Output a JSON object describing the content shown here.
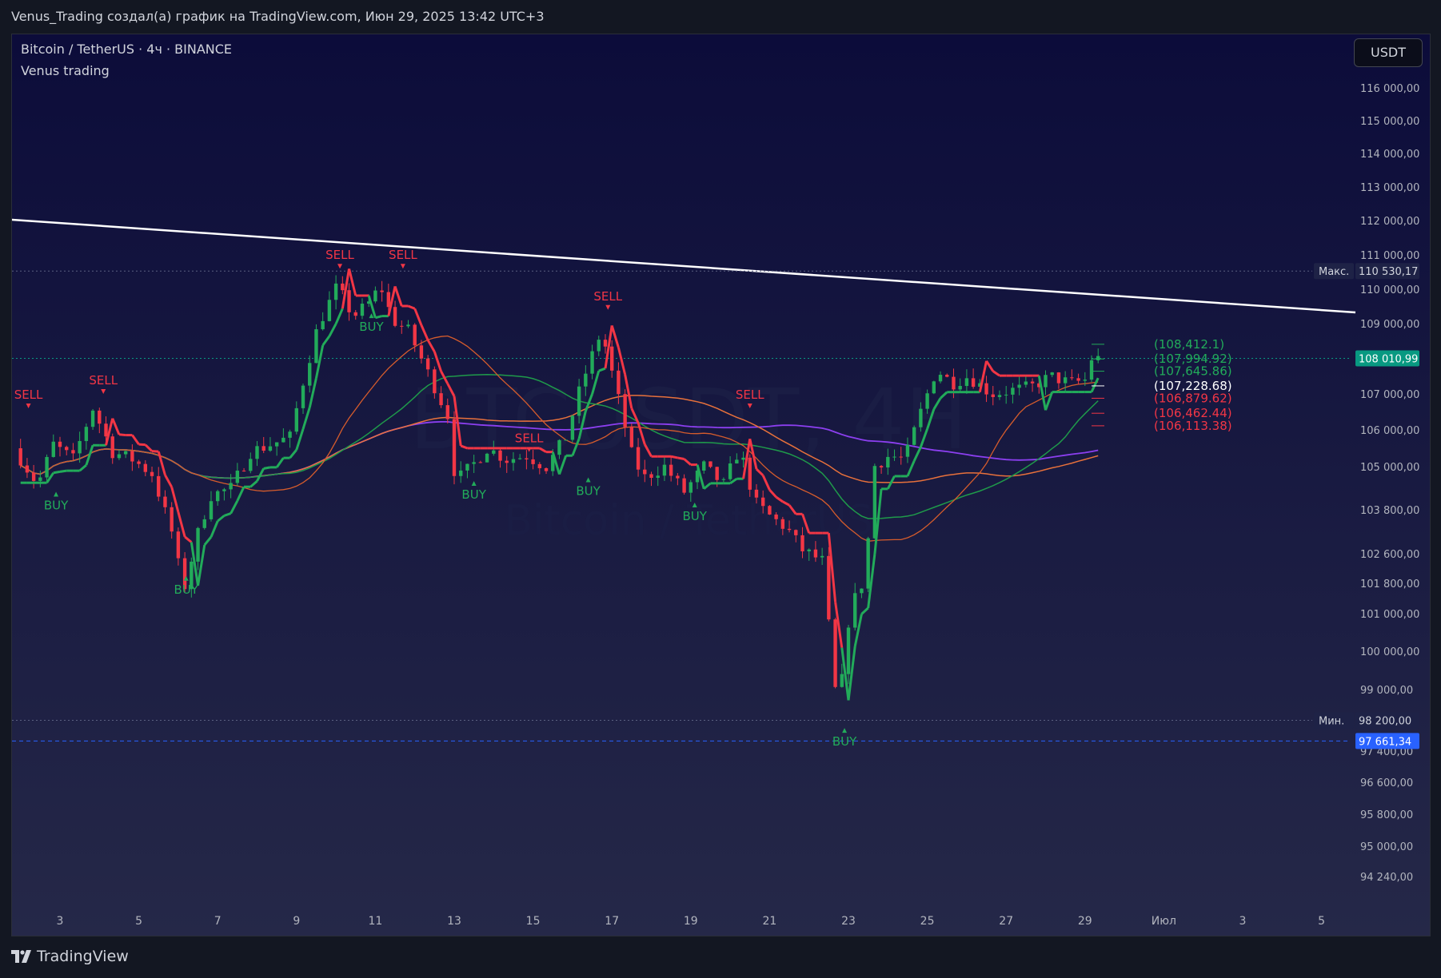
{
  "header": {
    "caption": "Venus_Trading создал(а) график на TradingView.com, Июн 29, 2025 13:42 UTC+3"
  },
  "legend": {
    "symbol": "Bitcoin / TetherUS · 4ч · BINANCE",
    "indicator": "Venus trading"
  },
  "currency_button": "USDT",
  "watermark": {
    "ticker": "BTCUSDT, 4H",
    "name": "Bitcoin / TetherUS"
  },
  "branding": {
    "logo_text": "TradingView"
  },
  "chart_data": {
    "type": "candlestick",
    "title": "Bitcoin / TetherUS · 4ч · BINANCE",
    "y_axis": {
      "ticks": [
        {
          "value": 116000,
          "label": "116 000,00"
        },
        {
          "value": 115000,
          "label": "115 000,00"
        },
        {
          "value": 114000,
          "label": "114 000,00"
        },
        {
          "value": 113000,
          "label": "113 000,00"
        },
        {
          "value": 112000,
          "label": "112 000,00"
        },
        {
          "value": 111000,
          "label": "111 000,00"
        },
        {
          "value": 110000,
          "label": "110 000,00"
        },
        {
          "value": 109000,
          "label": "109 000,00"
        },
        {
          "value": 107000,
          "label": "107 000,00"
        },
        {
          "value": 106000,
          "label": "106 000,00"
        },
        {
          "value": 105000,
          "label": "105 000,00"
        },
        {
          "value": 103800,
          "label": "103 800,00"
        },
        {
          "value": 102600,
          "label": "102 600,00"
        },
        {
          "value": 101800,
          "label": "101 800,00"
        },
        {
          "value": 101000,
          "label": "101 000,00"
        },
        {
          "value": 100000,
          "label": "100 000,00"
        },
        {
          "value": 99000,
          "label": "99 000,00"
        },
        {
          "value": 97400,
          "label": "97 400,00"
        },
        {
          "value": 96600,
          "label": "96 600,00"
        },
        {
          "value": 95800,
          "label": "95 800,00"
        },
        {
          "value": 95000,
          "label": "95 000,00"
        },
        {
          "value": 94240,
          "label": "94 240,00"
        }
      ]
    },
    "x_axis": {
      "labels": [
        "3",
        "5",
        "7",
        "9",
        "11",
        "13",
        "15",
        "17",
        "19",
        "21",
        "23",
        "25",
        "27",
        "29",
        "Июл",
        "3",
        "5"
      ]
    },
    "markers": {
      "max": {
        "label": "Макс.",
        "value": "110 530,17"
      },
      "min": {
        "label": "Мин.",
        "value": "98 200,00"
      },
      "last_price": {
        "value": "108 010,99",
        "color": "#089981"
      },
      "other_price": {
        "value": "97 661,34",
        "color": "#2962ff"
      }
    },
    "levels": [
      {
        "label": "(108,412.1)",
        "value": 108412.1,
        "color": "#22ab5a"
      },
      {
        "label": "(107,994.92)",
        "value": 107994.92,
        "color": "#22ab5a"
      },
      {
        "label": "(107,645.86)",
        "value": 107645.86,
        "color": "#22ab5a"
      },
      {
        "label": "(107,228.68)",
        "value": 107228.68,
        "color": "#ffffff"
      },
      {
        "label": "(106,879.62)",
        "value": 106879.62,
        "color": "#f23645"
      },
      {
        "label": "(106,462.44)",
        "value": 106462.44,
        "color": "#f23645"
      },
      {
        "label": "(106,113.38)",
        "value": 106113.38,
        "color": "#f23645"
      }
    ],
    "signals": [
      {
        "type": "SELL",
        "day": 2.2,
        "price": 106600
      },
      {
        "type": "BUY",
        "day": 2.9,
        "price": 104300
      },
      {
        "type": "SELL",
        "day": 4.1,
        "price": 107000
      },
      {
        "type": "BUY",
        "day": 6.2,
        "price": 102000
      },
      {
        "type": "SELL",
        "day": 10.1,
        "price": 110600
      },
      {
        "type": "BUY",
        "day": 10.9,
        "price": 109300
      },
      {
        "type": "SELL",
        "day": 11.7,
        "price": 110600
      },
      {
        "type": "BUY",
        "day": 13.5,
        "price": 104600
      },
      {
        "type": "SELL",
        "day": 14.9,
        "price": 105400
      },
      {
        "type": "BUY",
        "day": 16.4,
        "price": 104700
      },
      {
        "type": "SELL",
        "day": 16.9,
        "price": 109400
      },
      {
        "type": "BUY",
        "day": 19.1,
        "price": 104000
      },
      {
        "type": "SELL",
        "day": 20.5,
        "price": 106600
      },
      {
        "type": "BUY",
        "day": 22.9,
        "price": 98000
      }
    ],
    "colors": {
      "up": "#22ab5a",
      "down": "#f23645",
      "trendline": "#ffffff",
      "ma_green": "#1f9a4a",
      "ma_orange": "#e8713b",
      "ma_orange2": "#d65c2c",
      "ma_purple": "#8c3ff0"
    }
  }
}
